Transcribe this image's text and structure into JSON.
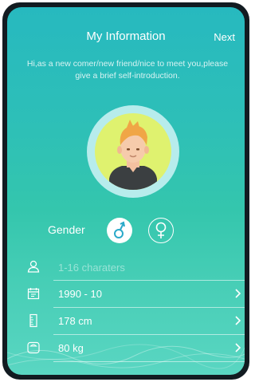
{
  "header": {
    "title": "My Information",
    "next_label": "Next"
  },
  "intro_text": "Hi,as a new comer/new friend/nice to meet you,please give a brief self-introduction.",
  "avatar": {
    "icon": "person-avatar-icon"
  },
  "gender": {
    "label": "Gender",
    "options": [
      "male",
      "female"
    ],
    "selected": "male"
  },
  "fields": {
    "nickname": {
      "placeholder": "1-16 charaters",
      "value": ""
    },
    "birthday": {
      "value": "1990 - 10"
    },
    "height": {
      "value": "178 cm"
    },
    "weight": {
      "value": "80 kg"
    }
  },
  "colors": {
    "background_top": "#27b9bf",
    "background_bottom": "#5ad6c2",
    "avatar_bg": "#dff26f",
    "selected_gender": "#2aa9c9"
  }
}
